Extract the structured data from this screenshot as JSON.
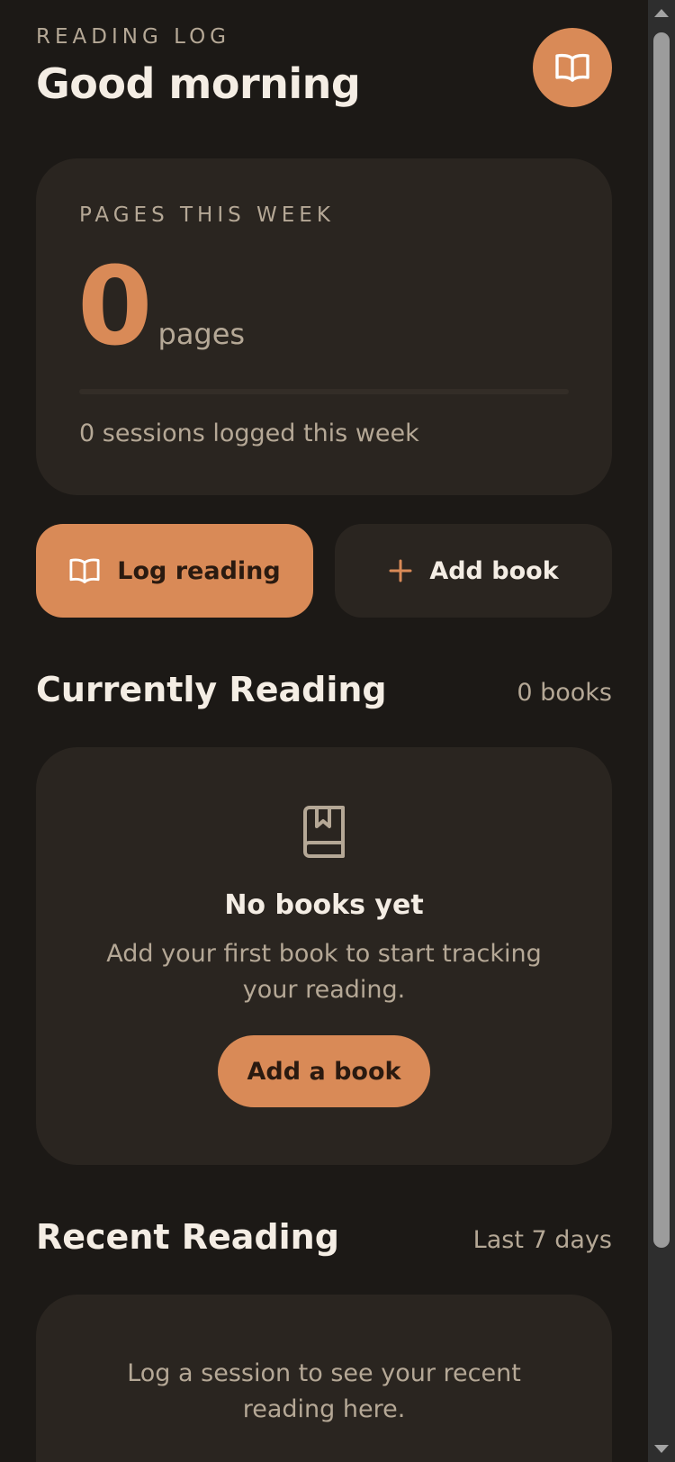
{
  "header": {
    "eyebrow": "READING LOG",
    "greeting": "Good morning",
    "avatar_icon": "open-book-icon"
  },
  "stats": {
    "label": "PAGES THIS WEEK",
    "value": "0",
    "unit": "pages",
    "progress_percent": 0,
    "sessions_text": "0 sessions logged this week"
  },
  "actions": {
    "log_reading": "Log reading",
    "add_book": "Add book"
  },
  "currently_reading": {
    "title": "Currently Reading",
    "count": "0 books",
    "empty_title": "No books yet",
    "empty_desc": "Add your first book to start tracking your reading.",
    "empty_button": "Add a book"
  },
  "recent_reading": {
    "title": "Recent Reading",
    "range": "Last 7 days",
    "empty_text": "Log a session to see your recent reading here."
  },
  "colors": {
    "background": "#1c1916",
    "card": "#2a2520",
    "accent": "#d98a57",
    "text_primary": "#f4ede4",
    "text_muted": "#b5a896"
  }
}
